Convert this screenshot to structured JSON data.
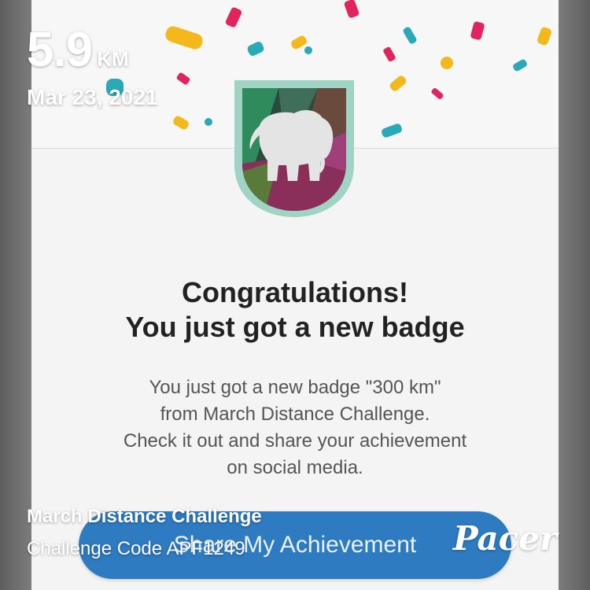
{
  "overlay": {
    "distance_value": "5.9",
    "distance_unit": "KM",
    "date": "Mar 23, 2021",
    "challenge_name": "March Distance Challenge",
    "challenge_code": "Challenge Code APF1249",
    "brand_logo": "Pacer"
  },
  "dialog": {
    "badge_icon": "elephant-badge-icon",
    "title_line1": "Congratulations!",
    "title_line2": "You just got a new badge",
    "description_lines": [
      "You just got a new badge \"300 km\"",
      "from March Distance Challenge.",
      "Check it out and share your achievement",
      "on social media."
    ],
    "share_button_label": "Share My Achievement"
  },
  "colors": {
    "button": "#2e7bc2",
    "badge_border": "#9fd3c4",
    "confetti": [
      "#e0245e",
      "#f2b81c",
      "#2aa9b8"
    ]
  }
}
